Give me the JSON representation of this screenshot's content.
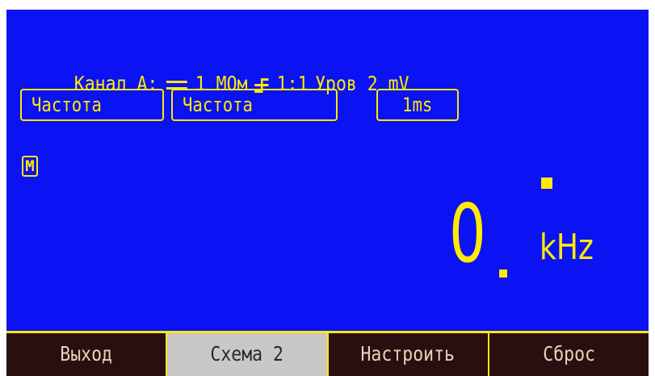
{
  "channel": {
    "label": "Канал А:",
    "coupling_icon": "dc-coupling-icon",
    "impedance": "1 МОм",
    "trigger_icon": "trigger-edge-icon",
    "ratio": "1:1",
    "level": "Уров 2 mV"
  },
  "selectors": {
    "mode": "Частота",
    "measurement": "Частота",
    "gate_time": "1ms"
  },
  "memory_badge": "M",
  "reading": {
    "value": "0",
    "unit": "kHz"
  },
  "softkeys": [
    {
      "label": "Выход",
      "active": false
    },
    {
      "label": "Схема 2",
      "active": true
    },
    {
      "label": "Настроить",
      "active": false
    },
    {
      "label": "Сброс",
      "active": false
    }
  ],
  "colors": {
    "screen_bg": "#0b12f3",
    "accent": "#ffea00",
    "softkey_bg": "#2a0f10",
    "softkey_active_bg": "#c8c8c8"
  }
}
